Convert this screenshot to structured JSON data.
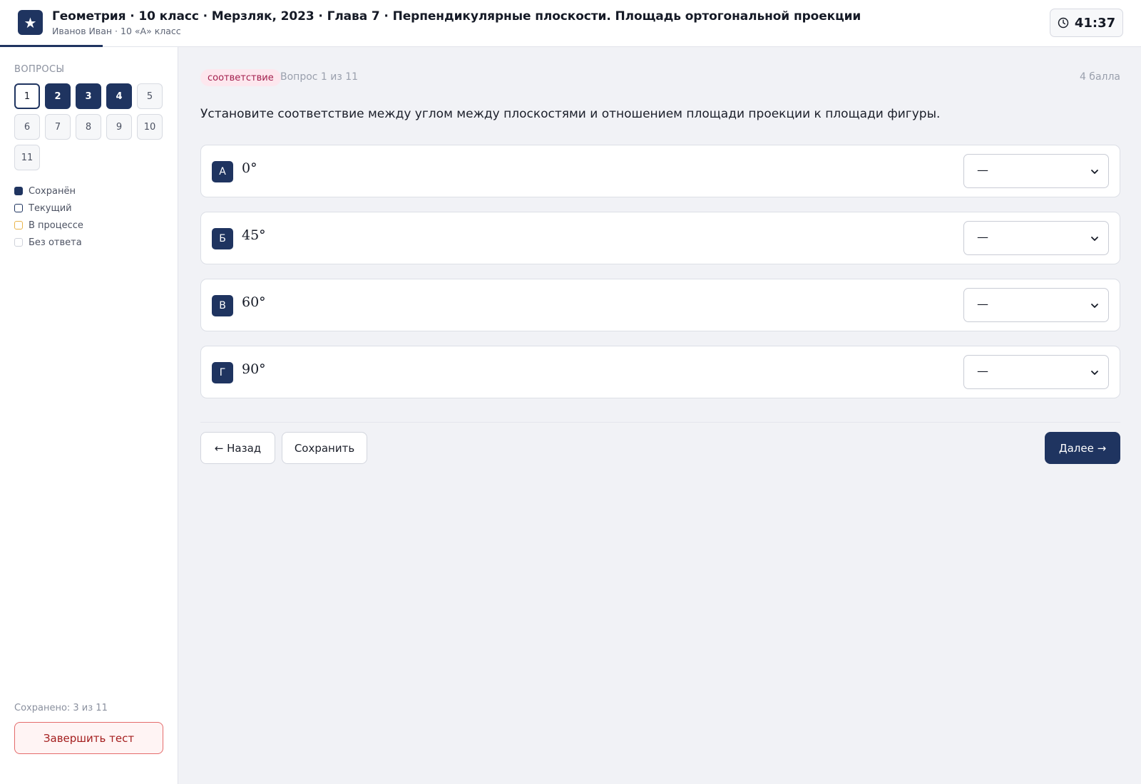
{
  "header": {
    "logo_glyph": "★",
    "title": "Геометрия · 10 класс · Мерзляк, 2023 · Глава 7 · Перпендикулярные плоскости. Площадь ортогональной проекции",
    "subtitle": "Иванов Иван · 10 «А» класс",
    "timer": "41:37"
  },
  "sidebar": {
    "heading": "ВОПРОСЫ",
    "questions": [
      {
        "label": "1",
        "state": "current"
      },
      {
        "label": "2",
        "state": "saved"
      },
      {
        "label": "3",
        "state": "saved"
      },
      {
        "label": "4",
        "state": "saved"
      },
      {
        "label": "5",
        "state": "empty"
      },
      {
        "label": "6",
        "state": "empty"
      },
      {
        "label": "7",
        "state": "empty"
      },
      {
        "label": "8",
        "state": "empty"
      },
      {
        "label": "9",
        "state": "empty"
      },
      {
        "label": "10",
        "state": "empty"
      },
      {
        "label": "11",
        "state": "empty"
      }
    ],
    "legend": {
      "saved": "Сохранён",
      "current": "Текущий",
      "in_progress": "В процессе",
      "unanswered": "Без ответа"
    },
    "saved_count": "Сохранено: 3 из 11",
    "finish_label": "Завершить тест"
  },
  "main": {
    "type_badge": "соответствие",
    "counter": "Вопрос 1 из 11",
    "points": "4 балла",
    "question": "Установите соответствие между углом между плоскостями и отношением площади проекции к площади фигуры.",
    "rows": [
      {
        "letter": "А",
        "angle": "0°",
        "selected": "—"
      },
      {
        "letter": "Б",
        "angle": "45°",
        "selected": "—"
      },
      {
        "letter": "В",
        "angle": "60°",
        "selected": "—"
      },
      {
        "letter": "Г",
        "angle": "90°",
        "selected": "—"
      }
    ],
    "back_label": "← Назад",
    "save_label": "Сохранить",
    "next_label": "Далее →"
  },
  "colors": {
    "accent": "#1f3460",
    "badge_bg": "#fde7ee",
    "badge_text": "#a31f4d",
    "finish_border": "#e46b6b",
    "in_progress": "#e9b44a"
  }
}
